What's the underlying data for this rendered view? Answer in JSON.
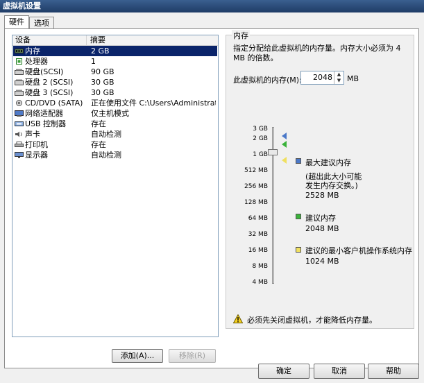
{
  "window": {
    "title": "虚拟机设置"
  },
  "tabs": [
    {
      "label": "硬件"
    },
    {
      "label": "选项"
    }
  ],
  "device_list": {
    "headers": {
      "device": "设备",
      "summary": "摘要"
    },
    "rows": [
      {
        "name": "内存",
        "summary": "2 GB",
        "icon": "memory-icon",
        "selected": true
      },
      {
        "name": "处理器",
        "summary": "1",
        "icon": "processor-icon"
      },
      {
        "name": "硬盘(SCSI)",
        "summary": "90 GB",
        "icon": "harddisk-icon"
      },
      {
        "name": "硬盘 2 (SCSI)",
        "summary": "30 GB",
        "icon": "harddisk-icon"
      },
      {
        "name": "硬盘 3 (SCSI)",
        "summary": "30 GB",
        "icon": "harddisk-icon"
      },
      {
        "name": "CD/DVD (SATA)",
        "summary": "正在使用文件 C:\\Users\\Administrato...",
        "icon": "cd-dvd-icon"
      },
      {
        "name": "网络适配器",
        "summary": "仅主机模式",
        "icon": "network-adapter-icon"
      },
      {
        "name": "USB 控制器",
        "summary": "存在",
        "icon": "usb-icon"
      },
      {
        "name": "声卡",
        "summary": "自动检测",
        "icon": "sound-card-icon"
      },
      {
        "name": "打印机",
        "summary": "存在",
        "icon": "printer-icon"
      },
      {
        "name": "显示器",
        "summary": "自动检测",
        "icon": "display-icon"
      }
    ],
    "add_label": "添加(A)...",
    "remove_label": "移除(R)"
  },
  "memory_panel": {
    "title": "内存",
    "description": "指定分配给此虚拟机的内存量。内存大小必须为 4 MB 的倍数。",
    "memory_label": "此虚拟机的内存(M):",
    "memory_value": "2048",
    "unit": "MB",
    "slider_ticks": [
      "3 GB",
      "2 GB",
      "1 GB",
      "512 MB",
      "256 MB",
      "128 MB",
      "64 MB",
      "32 MB",
      "16 MB",
      "8 MB",
      "4 MB"
    ],
    "slider_value_mb": 2048,
    "legend": {
      "max_recommended": {
        "title": "最大建议内存",
        "note_line1": "(超出此大小可能",
        "note_line2": "发生内存交换。)",
        "value": "2528 MB",
        "color": "#4a78c8"
      },
      "recommended": {
        "title": "建议内存",
        "value": "2048 MB",
        "color": "#3ab23a"
      },
      "min_guest": {
        "title": "建议的最小客户机操作系统内存",
        "value": "1024 MB",
        "color": "#f0e060"
      }
    },
    "warning": "必须先关闭虚拟机，才能降低内存量。"
  },
  "footer": {
    "ok_label": "确定",
    "cancel_label": "取消",
    "help_label": "帮助"
  }
}
